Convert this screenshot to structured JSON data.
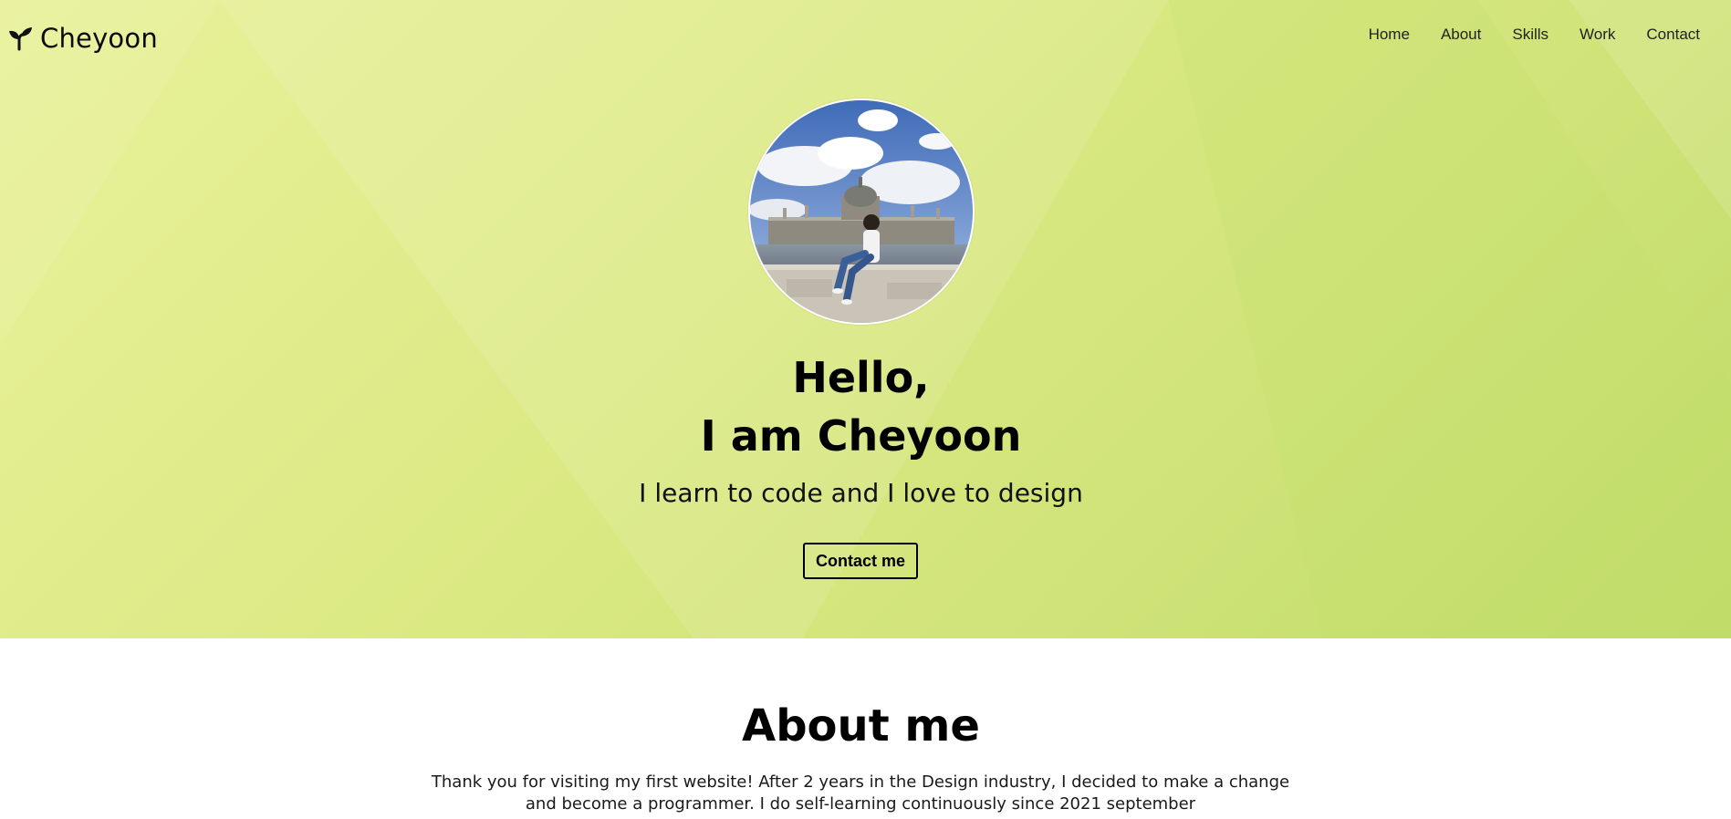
{
  "brand": {
    "name": "Cheyoon",
    "icon": "sprout-icon"
  },
  "nav": {
    "items": [
      {
        "label": "Home"
      },
      {
        "label": "About"
      },
      {
        "label": "Skills"
      },
      {
        "label": "Work"
      },
      {
        "label": "Contact"
      }
    ]
  },
  "hero": {
    "greeting_line1": "Hello,",
    "greeting_line2": "I am Cheyoon",
    "tagline": "I learn to code and I love to design",
    "contact_button": "Contact me",
    "avatar": "profile-photo"
  },
  "about": {
    "title": "About me",
    "text": "Thank you for visiting my first website! After 2 years in the Design industry, I decided to make a change and become a programmer. I do self-learning continuously since 2021 september"
  },
  "colors": {
    "hero_light": "#e9f19a",
    "hero_dark": "#bfdb68",
    "text": "#000000",
    "background": "#ffffff"
  }
}
